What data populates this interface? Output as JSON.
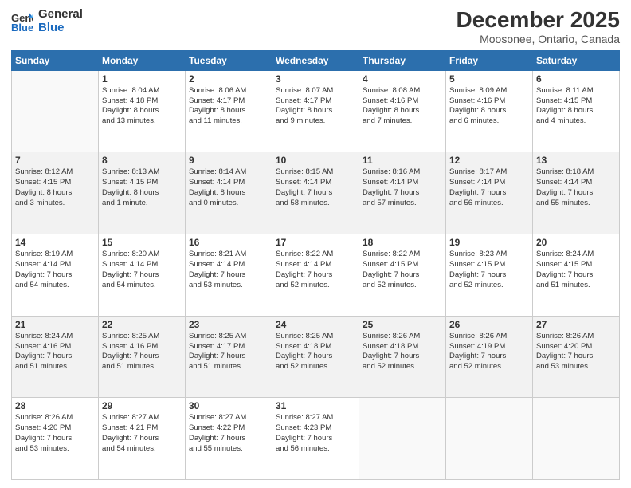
{
  "header": {
    "logo_line1": "General",
    "logo_line2": "Blue",
    "month": "December 2025",
    "location": "Moosonee, Ontario, Canada"
  },
  "weekdays": [
    "Sunday",
    "Monday",
    "Tuesday",
    "Wednesday",
    "Thursday",
    "Friday",
    "Saturday"
  ],
  "weeks": [
    [
      {
        "num": "",
        "empty": true
      },
      {
        "num": "1",
        "rise": "8:04 AM",
        "set": "4:18 PM",
        "hours": "8 hours",
        "mins": "and 13 minutes."
      },
      {
        "num": "2",
        "rise": "8:06 AM",
        "set": "4:17 PM",
        "hours": "8 hours",
        "mins": "and 11 minutes."
      },
      {
        "num": "3",
        "rise": "8:07 AM",
        "set": "4:17 PM",
        "hours": "8 hours",
        "mins": "and 9 minutes."
      },
      {
        "num": "4",
        "rise": "8:08 AM",
        "set": "4:16 PM",
        "hours": "8 hours",
        "mins": "and 7 minutes."
      },
      {
        "num": "5",
        "rise": "8:09 AM",
        "set": "4:16 PM",
        "hours": "8 hours",
        "mins": "and 6 minutes."
      },
      {
        "num": "6",
        "rise": "8:11 AM",
        "set": "4:15 PM",
        "hours": "8 hours",
        "mins": "and 4 minutes."
      }
    ],
    [
      {
        "num": "7",
        "rise": "8:12 AM",
        "set": "4:15 PM",
        "hours": "8 hours",
        "mins": "and 3 minutes."
      },
      {
        "num": "8",
        "rise": "8:13 AM",
        "set": "4:15 PM",
        "hours": "8 hours",
        "mins": "and 1 minute."
      },
      {
        "num": "9",
        "rise": "8:14 AM",
        "set": "4:14 PM",
        "hours": "8 hours",
        "mins": "and 0 minutes."
      },
      {
        "num": "10",
        "rise": "8:15 AM",
        "set": "4:14 PM",
        "hours": "7 hours",
        "mins": "and 58 minutes."
      },
      {
        "num": "11",
        "rise": "8:16 AM",
        "set": "4:14 PM",
        "hours": "7 hours",
        "mins": "and 57 minutes."
      },
      {
        "num": "12",
        "rise": "8:17 AM",
        "set": "4:14 PM",
        "hours": "7 hours",
        "mins": "and 56 minutes."
      },
      {
        "num": "13",
        "rise": "8:18 AM",
        "set": "4:14 PM",
        "hours": "7 hours",
        "mins": "and 55 minutes."
      }
    ],
    [
      {
        "num": "14",
        "rise": "8:19 AM",
        "set": "4:14 PM",
        "hours": "7 hours",
        "mins": "and 54 minutes."
      },
      {
        "num": "15",
        "rise": "8:20 AM",
        "set": "4:14 PM",
        "hours": "7 hours",
        "mins": "and 54 minutes."
      },
      {
        "num": "16",
        "rise": "8:21 AM",
        "set": "4:14 PM",
        "hours": "7 hours",
        "mins": "and 53 minutes."
      },
      {
        "num": "17",
        "rise": "8:22 AM",
        "set": "4:14 PM",
        "hours": "7 hours",
        "mins": "and 52 minutes."
      },
      {
        "num": "18",
        "rise": "8:22 AM",
        "set": "4:15 PM",
        "hours": "7 hours",
        "mins": "and 52 minutes."
      },
      {
        "num": "19",
        "rise": "8:23 AM",
        "set": "4:15 PM",
        "hours": "7 hours",
        "mins": "and 52 minutes."
      },
      {
        "num": "20",
        "rise": "8:24 AM",
        "set": "4:15 PM",
        "hours": "7 hours",
        "mins": "and 51 minutes."
      }
    ],
    [
      {
        "num": "21",
        "rise": "8:24 AM",
        "set": "4:16 PM",
        "hours": "7 hours",
        "mins": "and 51 minutes."
      },
      {
        "num": "22",
        "rise": "8:25 AM",
        "set": "4:16 PM",
        "hours": "7 hours",
        "mins": "and 51 minutes."
      },
      {
        "num": "23",
        "rise": "8:25 AM",
        "set": "4:17 PM",
        "hours": "7 hours",
        "mins": "and 51 minutes."
      },
      {
        "num": "24",
        "rise": "8:25 AM",
        "set": "4:18 PM",
        "hours": "7 hours",
        "mins": "and 52 minutes."
      },
      {
        "num": "25",
        "rise": "8:26 AM",
        "set": "4:18 PM",
        "hours": "7 hours",
        "mins": "and 52 minutes."
      },
      {
        "num": "26",
        "rise": "8:26 AM",
        "set": "4:19 PM",
        "hours": "7 hours",
        "mins": "and 52 minutes."
      },
      {
        "num": "27",
        "rise": "8:26 AM",
        "set": "4:20 PM",
        "hours": "7 hours",
        "mins": "and 53 minutes."
      }
    ],
    [
      {
        "num": "28",
        "rise": "8:26 AM",
        "set": "4:20 PM",
        "hours": "7 hours",
        "mins": "and 53 minutes."
      },
      {
        "num": "29",
        "rise": "8:27 AM",
        "set": "4:21 PM",
        "hours": "7 hours",
        "mins": "and 54 minutes."
      },
      {
        "num": "30",
        "rise": "8:27 AM",
        "set": "4:22 PM",
        "hours": "7 hours",
        "mins": "and 55 minutes."
      },
      {
        "num": "31",
        "rise": "8:27 AM",
        "set": "4:23 PM",
        "hours": "7 hours",
        "mins": "and 56 minutes."
      },
      {
        "num": "",
        "empty": true
      },
      {
        "num": "",
        "empty": true
      },
      {
        "num": "",
        "empty": true
      }
    ]
  ],
  "labels": {
    "sunrise": "Sunrise:",
    "sunset": "Sunset:",
    "daylight": "Daylight:"
  }
}
